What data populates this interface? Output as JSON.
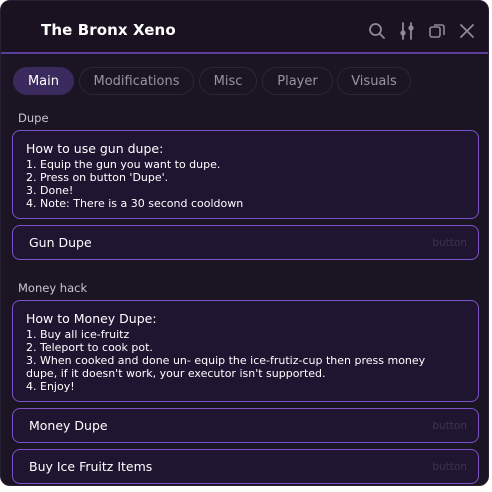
{
  "window": {
    "title": "The Bronx Xeno",
    "controls": [
      "search-icon",
      "sliders-icon",
      "duplicate-icon",
      "close-icon"
    ]
  },
  "tabs": [
    {
      "label": "Main",
      "active": true
    },
    {
      "label": "Modifications",
      "active": false
    },
    {
      "label": "Misc",
      "active": false
    },
    {
      "label": "Player",
      "active": false
    },
    {
      "label": "Visuals",
      "active": false
    }
  ],
  "sections": {
    "dupe": {
      "label": "Dupe",
      "info_title": "How to use gun dupe:",
      "info_lines": [
        "1. Equip the gun you want to dupe.",
        "2. Press on button 'Dupe'.",
        "3. Done!",
        "4. Note: There is a 30 second cooldown"
      ],
      "buttons": [
        {
          "label": "Gun Dupe",
          "type": "button"
        }
      ]
    },
    "money": {
      "label": "Money hack",
      "info_title": "How to Money Dupe:",
      "info_lines": [
        "1. Buy all ice-fruitz",
        "2. Teleport to cook pot.",
        "3. When cooked and done un- equip the ice-frutiz-cup then press money",
        "dupe, if it doesn't work, your executor isn't supported.",
        "4. Enjoy!"
      ],
      "buttons": [
        {
          "label": "Money Dupe",
          "type": "button"
        },
        {
          "label": "Buy Ice Fruitz Items",
          "type": "button"
        }
      ]
    }
  },
  "colors": {
    "background": "#1b1423",
    "accent": "#7b52c9",
    "tab_active": "#3a2a5e",
    "text": "#ffffff",
    "muted": "#9a93a5"
  }
}
